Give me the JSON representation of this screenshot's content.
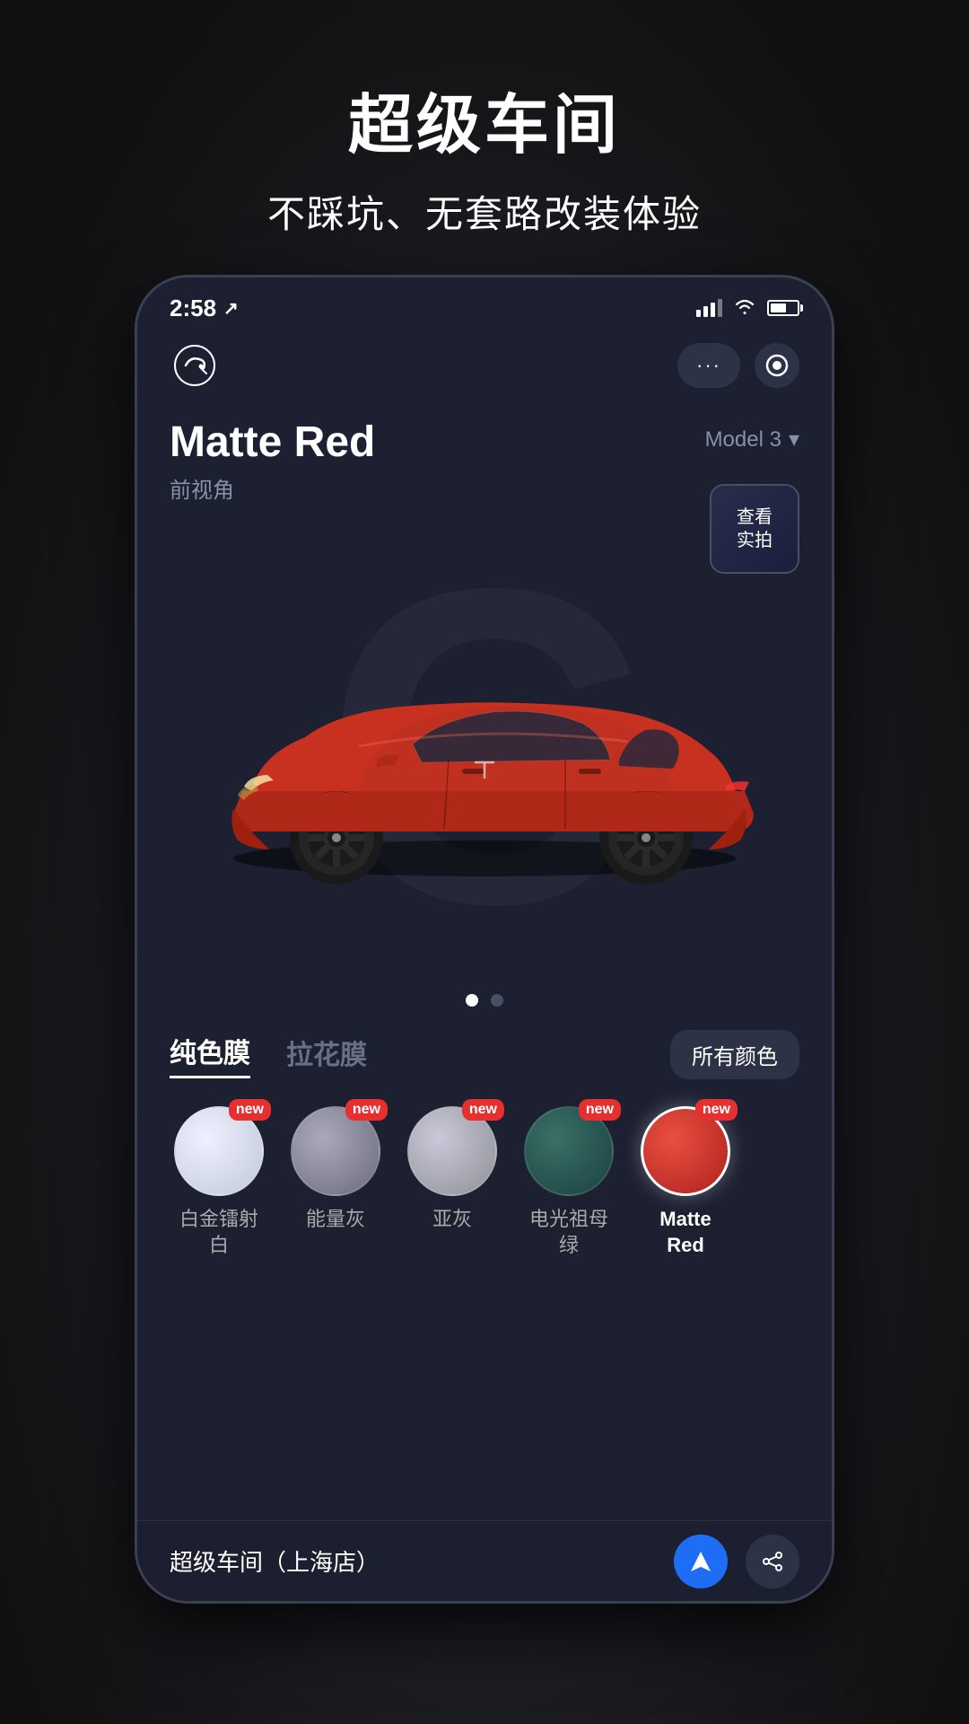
{
  "background": {
    "color": "#1a1a1a"
  },
  "top_section": {
    "title": "超级车间",
    "subtitle": "不踩坑、无套路改装体验"
  },
  "status_bar": {
    "time": "2:58",
    "location_icon": "↗"
  },
  "app_header": {
    "logo_alt": "app-logo",
    "menu_dots": "···",
    "record_icon": "⊙"
  },
  "car_info": {
    "name": "Matte Red",
    "angle": "前视角",
    "model": "Model 3",
    "real_photo_label": "查看\n实拍"
  },
  "page_dots": {
    "active_index": 0,
    "total": 2
  },
  "film_tabs": {
    "tabs": [
      {
        "label": "纯色膜",
        "active": true
      },
      {
        "label": "拉花膜",
        "active": false
      }
    ],
    "all_colors_label": "所有颜色"
  },
  "color_swatches": [
    {
      "label": "白金镭射\n白",
      "color_from": "#e8e8f0",
      "color_to": "#c0c8d8",
      "new": true,
      "active": false
    },
    {
      "label": "能量灰",
      "color_from": "#9a9aaa",
      "color_to": "#6a6a7a",
      "new": true,
      "active": false
    },
    {
      "label": "亚灰",
      "color_from": "#b8b8c8",
      "color_to": "#909098",
      "new": true,
      "active": false
    },
    {
      "label": "电光祖母\n绿",
      "color_from": "#2a6058",
      "color_to": "#1a4040",
      "new": true,
      "active": false
    },
    {
      "label": "Matte\nRed",
      "color_from": "#e04030",
      "color_to": "#b02020",
      "new": true,
      "active": true
    }
  ],
  "bottom_bar": {
    "store_name": "超级车间（上海店）"
  }
}
